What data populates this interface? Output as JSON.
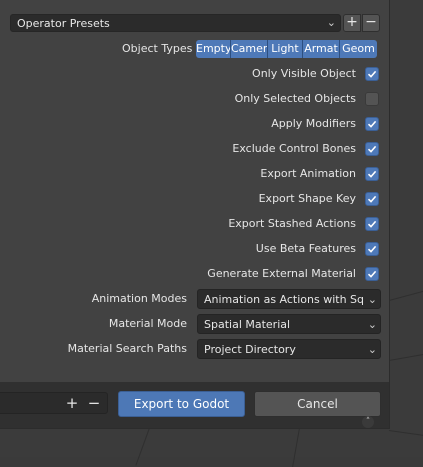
{
  "presets": {
    "label": "Operator Presets",
    "chevron_icon": "chevron-down-icon",
    "add_icon": "plus-icon",
    "remove_icon": "minus-icon"
  },
  "object_types": {
    "label": "Object Types",
    "options": [
      "Empty",
      "Camer",
      "Light",
      "Armat",
      "Geom"
    ],
    "accent": "#4e79b8"
  },
  "checkboxes": [
    {
      "label": "Only Visible Object",
      "checked": true
    },
    {
      "label": "Only Selected Objects",
      "checked": false
    },
    {
      "label": "Apply Modifiers",
      "checked": true
    },
    {
      "label": "Exclude Control Bones",
      "checked": true
    },
    {
      "label": "Export Animation",
      "checked": true
    },
    {
      "label": "Export Shape Key",
      "checked": true
    },
    {
      "label": "Export Stashed Actions",
      "checked": true
    },
    {
      "label": "Use Beta Features",
      "checked": true
    },
    {
      "label": "Generate External Material",
      "checked": true
    }
  ],
  "dropdowns": [
    {
      "label": "Animation Modes",
      "value": "Animation as Actions with Squash"
    },
    {
      "label": "Material Mode",
      "value": "Spatial Material"
    },
    {
      "label": "Material Search Paths",
      "value": "Project Directory"
    }
  ],
  "footer": {
    "add_icon": "plus-icon",
    "remove_icon": "minus-icon",
    "export_label": "Export to Godot",
    "cancel_label": "Cancel"
  }
}
